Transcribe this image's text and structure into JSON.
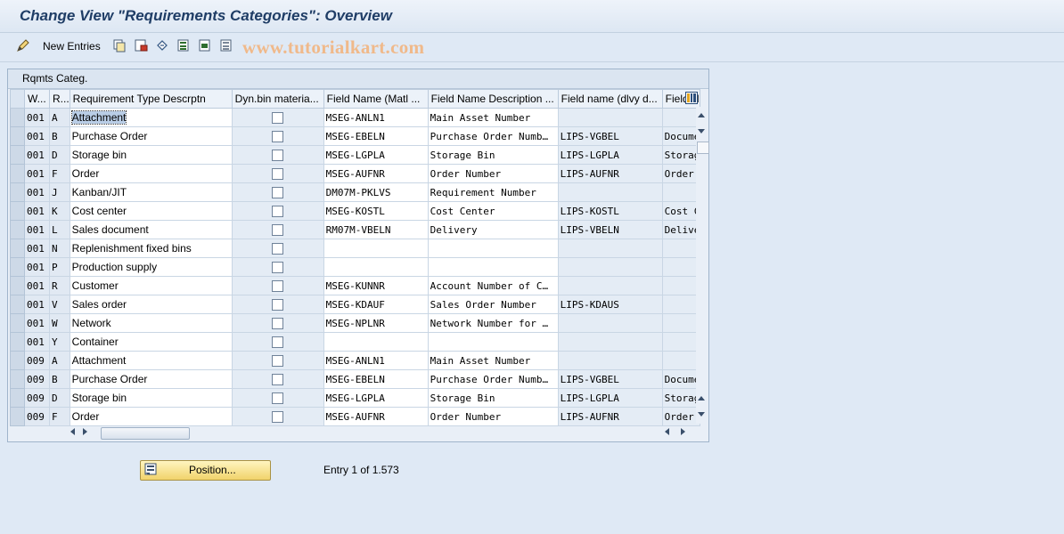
{
  "window": {
    "title": "Change View \"Requirements Categories\": Overview"
  },
  "toolbar": {
    "new_entries_label": "New Entries",
    "watermark": "www.tutorialkart.com"
  },
  "panel": {
    "title": "Rqmts Categ."
  },
  "table": {
    "columns": [
      "W...",
      "R...",
      "Requirement Type Descrptn",
      "Dyn.bin materia...",
      "Field Name (Matl ...",
      "Field Name Description ...",
      "Field name (dlvy d...",
      "Field N"
    ],
    "rows": [
      {
        "w": "001",
        "r": "A",
        "desc": "Attachment",
        "dyn": false,
        "field": "MSEG-ANLN1",
        "fdesc": "Main Asset Number",
        "dlvy": "",
        "fn": ""
      },
      {
        "w": "001",
        "r": "B",
        "desc": "Purchase Order",
        "dyn": false,
        "field": "MSEG-EBELN",
        "fdesc": "Purchase Order Numb…",
        "dlvy": "LIPS-VGBEL",
        "fn": "Docume"
      },
      {
        "w": "001",
        "r": "D",
        "desc": "Storage bin",
        "dyn": false,
        "field": "MSEG-LGPLA",
        "fdesc": "Storage Bin",
        "dlvy": "LIPS-LGPLA",
        "fn": "Storag"
      },
      {
        "w": "001",
        "r": "F",
        "desc": "Order",
        "dyn": false,
        "field": "MSEG-AUFNR",
        "fdesc": "Order Number",
        "dlvy": "LIPS-AUFNR",
        "fn": "Order"
      },
      {
        "w": "001",
        "r": "J",
        "desc": "Kanban/JIT",
        "dyn": false,
        "field": "DM07M-PKLVS",
        "fdesc": "Requirement Number",
        "dlvy": "",
        "fn": ""
      },
      {
        "w": "001",
        "r": "K",
        "desc": "Cost center",
        "dyn": false,
        "field": "MSEG-KOSTL",
        "fdesc": "Cost Center",
        "dlvy": "LIPS-KOSTL",
        "fn": "Cost C"
      },
      {
        "w": "001",
        "r": "L",
        "desc": "Sales document",
        "dyn": false,
        "field": "RM07M-VBELN",
        "fdesc": "Delivery",
        "dlvy": "LIPS-VBELN",
        "fn": "Delive"
      },
      {
        "w": "001",
        "r": "N",
        "desc": "Replenishment fixed bins",
        "dyn": false,
        "field": "",
        "fdesc": "",
        "dlvy": "",
        "fn": ""
      },
      {
        "w": "001",
        "r": "P",
        "desc": "Production supply",
        "dyn": false,
        "field": "",
        "fdesc": "",
        "dlvy": "",
        "fn": ""
      },
      {
        "w": "001",
        "r": "R",
        "desc": "Customer",
        "dyn": false,
        "field": "MSEG-KUNNR",
        "fdesc": "Account Number of C…",
        "dlvy": "",
        "fn": ""
      },
      {
        "w": "001",
        "r": "V",
        "desc": "Sales order",
        "dyn": false,
        "field": "MSEG-KDAUF",
        "fdesc": "Sales Order Number",
        "dlvy": "LIPS-KDAUS",
        "fn": ""
      },
      {
        "w": "001",
        "r": "W",
        "desc": "Network",
        "dyn": false,
        "field": "MSEG-NPLNR",
        "fdesc": "Network Number for …",
        "dlvy": "",
        "fn": ""
      },
      {
        "w": "001",
        "r": "Y",
        "desc": "Container",
        "dyn": false,
        "field": "",
        "fdesc": "",
        "dlvy": "",
        "fn": ""
      },
      {
        "w": "009",
        "r": "A",
        "desc": "Attachment",
        "dyn": false,
        "field": "MSEG-ANLN1",
        "fdesc": "Main Asset Number",
        "dlvy": "",
        "fn": ""
      },
      {
        "w": "009",
        "r": "B",
        "desc": "Purchase Order",
        "dyn": false,
        "field": "MSEG-EBELN",
        "fdesc": "Purchase Order Numb…",
        "dlvy": "LIPS-VGBEL",
        "fn": "Docume"
      },
      {
        "w": "009",
        "r": "D",
        "desc": "Storage bin",
        "dyn": false,
        "field": "MSEG-LGPLA",
        "fdesc": "Storage Bin",
        "dlvy": "LIPS-LGPLA",
        "fn": "Storag"
      },
      {
        "w": "009",
        "r": "F",
        "desc": "Order",
        "dyn": false,
        "field": "MSEG-AUFNR",
        "fdesc": "Order Number",
        "dlvy": "LIPS-AUFNR",
        "fn": "Order"
      }
    ]
  },
  "footer": {
    "position_button_label": "Position...",
    "entry_text": "Entry 1 of 1.573"
  }
}
